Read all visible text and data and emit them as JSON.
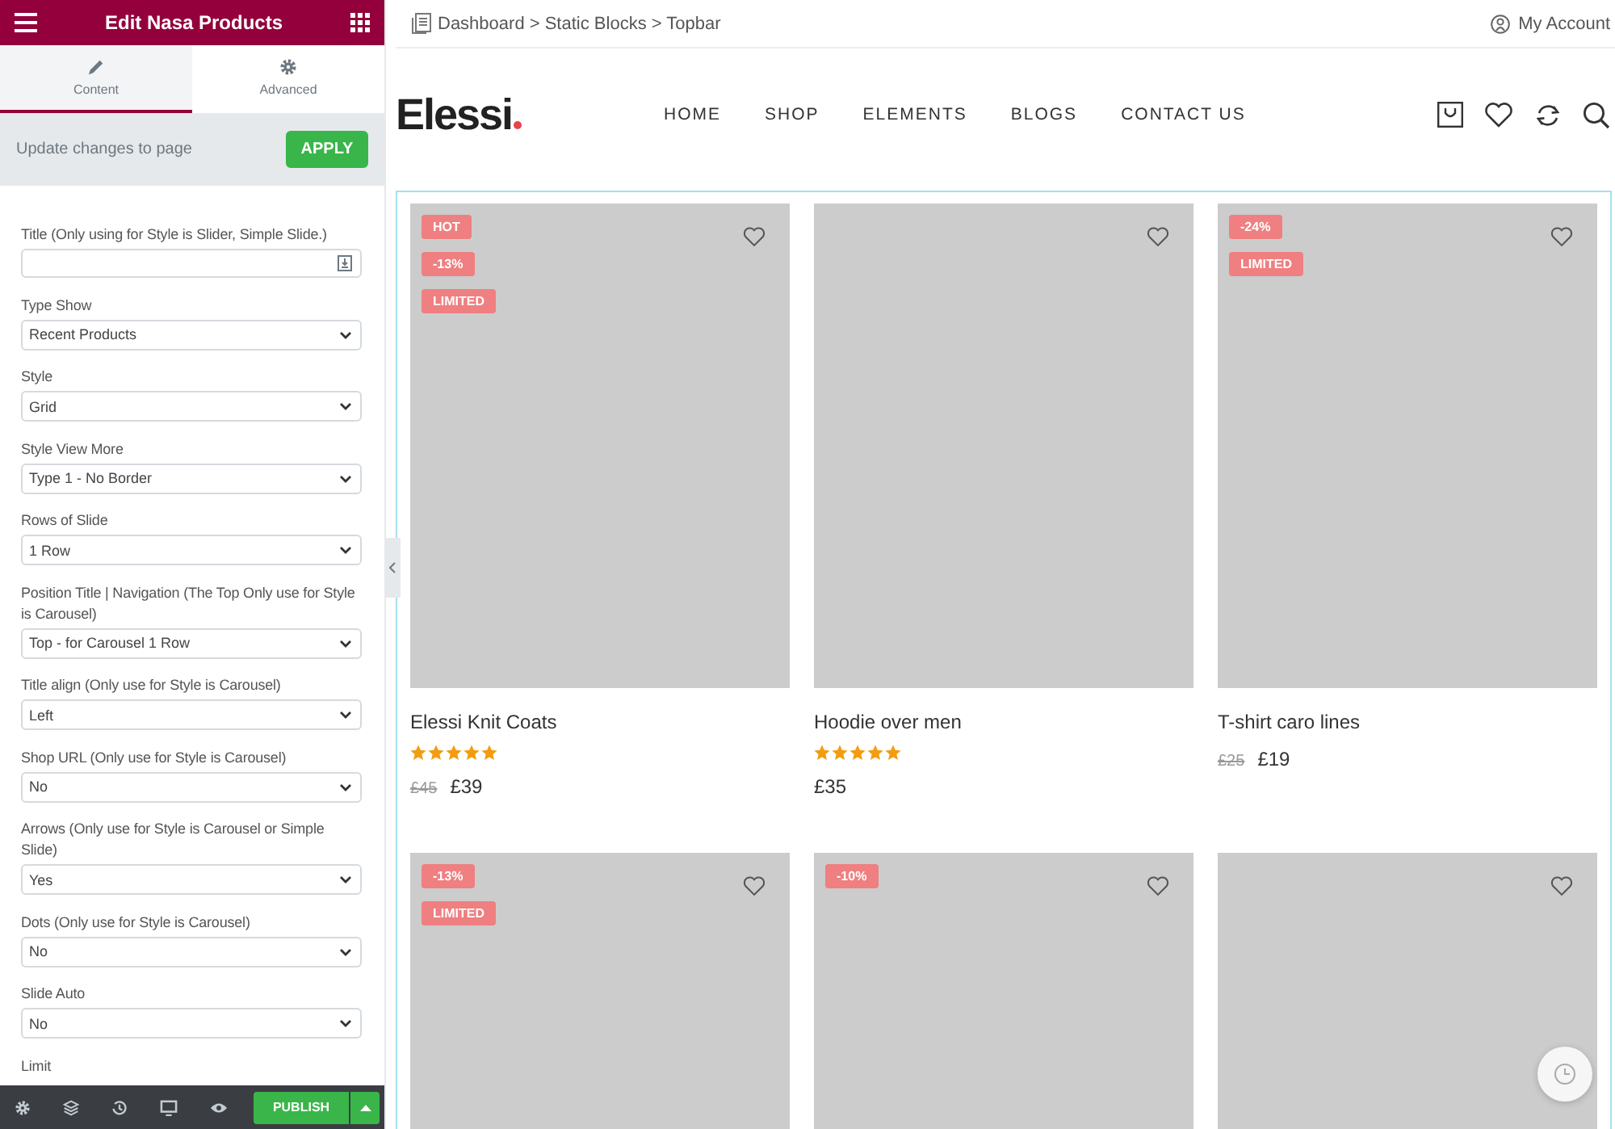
{
  "panel": {
    "title": "Edit Nasa Products",
    "tabs": [
      {
        "label": "Content",
        "selected": true
      },
      {
        "label": "Advanced",
        "selected": false
      }
    ],
    "update_text": "Update changes to page",
    "apply_button": "APPLY",
    "fields": [
      {
        "kind": "text",
        "label": "Title (Only using for Style is Slider, Simple Slide.)"
      },
      {
        "kind": "select",
        "label": "Type Show",
        "value": "Recent Products"
      },
      {
        "kind": "select",
        "label": "Style",
        "value": "Grid"
      },
      {
        "kind": "select",
        "label": "Style View More",
        "value": "Type 1 - No Border"
      },
      {
        "kind": "select",
        "label": "Rows of Slide",
        "value": "1 Row"
      },
      {
        "kind": "select",
        "label": "Position Title | Navigation (The Top Only use for Style is Carousel)",
        "value": "Top - for Carousel 1 Row"
      },
      {
        "kind": "select",
        "label": "Title align (Only use for Style is Carousel)",
        "value": "Left"
      },
      {
        "kind": "select",
        "label": "Shop URL (Only use for Style is Carousel)",
        "value": "No"
      },
      {
        "kind": "select",
        "label": "Arrows (Only use for Style is Carousel or Simple Slide)",
        "value": "Yes"
      },
      {
        "kind": "select",
        "label": "Dots (Only use for Style is Carousel)",
        "value": "No"
      },
      {
        "kind": "select",
        "label": "Slide Auto",
        "value": "No"
      },
      {
        "kind": "label",
        "label": "Limit"
      }
    ],
    "publish_button": "PUBLISH"
  },
  "topbar": {
    "breadcrumb": "Dashboard > Static Blocks > Topbar",
    "account": "My Account"
  },
  "header": {
    "logo": "Elessi",
    "nav": [
      "HOME",
      "SHOP",
      "ELEMENTS",
      "BLOGS",
      "CONTACT US"
    ]
  },
  "products": [
    {
      "badges": [
        "HOT",
        "-13%",
        "LIMITED"
      ],
      "wishlisted": false,
      "name": "Elessi Knit Coats",
      "stars": 5,
      "old_price": "£45",
      "price": "£39"
    },
    {
      "wishlisted": false,
      "name": "Hoodie over men",
      "stars": 5,
      "price": "£35"
    },
    {
      "badges": [
        "-24%",
        "LIMITED"
      ],
      "wishlisted": false,
      "name": "T-shirt caro lines",
      "old_price": "£25",
      "price": "£19"
    },
    {
      "badges": [
        "-13%",
        "LIMITED"
      ],
      "wishlisted": false
    },
    {
      "badges": [
        "-10%"
      ],
      "wishlisted": false
    },
    {
      "wishlisted": false
    }
  ]
}
